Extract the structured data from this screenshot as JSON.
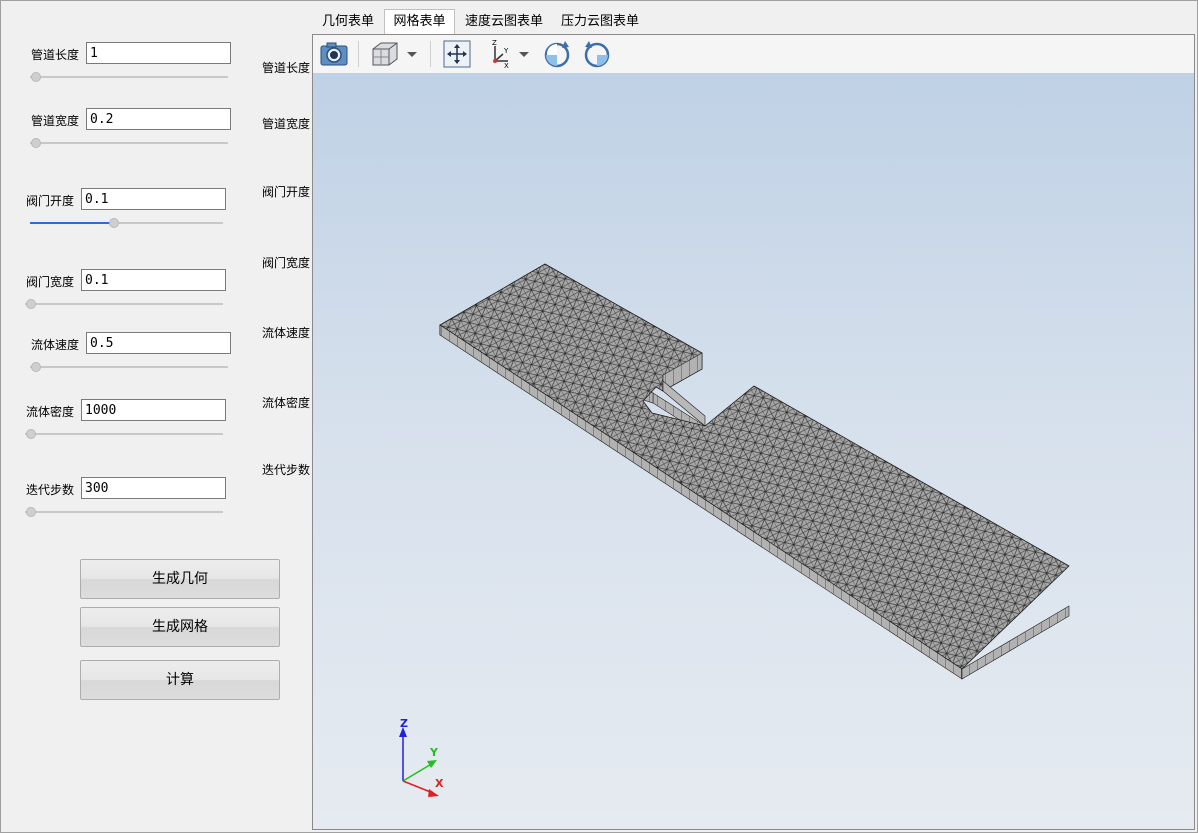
{
  "params": [
    {
      "label": "管道长度",
      "value": "1",
      "slider_fraction": 0.0
    },
    {
      "label": "管道宽度",
      "value": "0.2",
      "slider_fraction": 0.0
    },
    {
      "label": "阀门开度",
      "value": "0.1",
      "slider_fraction": 0.43
    },
    {
      "label": "阀门宽度",
      "value": "0.1",
      "slider_fraction": 0.0
    },
    {
      "label": "流体速度",
      "value": "0.5",
      "slider_fraction": 0.0
    },
    {
      "label": "流体密度",
      "value": "1000",
      "slider_fraction": 0.0
    },
    {
      "label": "迭代步数",
      "value": "300",
      "slider_fraction": 0.0
    }
  ],
  "buttons": {
    "generate_geometry": "生成几何",
    "generate_mesh": "生成网格",
    "compute": "计算"
  },
  "mid_labels": [
    "管道长度",
    "管道宽度",
    "阀门开度",
    "阀门宽度",
    "流体速度",
    "流体密度",
    "迭代步数"
  ],
  "tabs": [
    {
      "label": "几何表单",
      "active": false
    },
    {
      "label": "网格表单",
      "active": true
    },
    {
      "label": "速度云图表单",
      "active": false
    },
    {
      "label": "压力云图表单",
      "active": false
    }
  ],
  "toolbar_icons": [
    "camera-icon",
    "view-cube-icon",
    "dropdown-arrow-icon",
    "fit-view-icon",
    "axes-orientation-icon",
    "dropdown-arrow-icon",
    "rotate-clockwise-icon",
    "rotate-counterclockwise-icon"
  ],
  "axes": {
    "x": "X",
    "y": "Y",
    "z": "Z"
  },
  "colors": {
    "accent": "#2a6fd1",
    "mesh_face": "#a9a9a9",
    "mesh_lines": "#202020",
    "axis_x": "#e02020",
    "axis_y": "#20c020",
    "axis_z": "#2020e0"
  }
}
